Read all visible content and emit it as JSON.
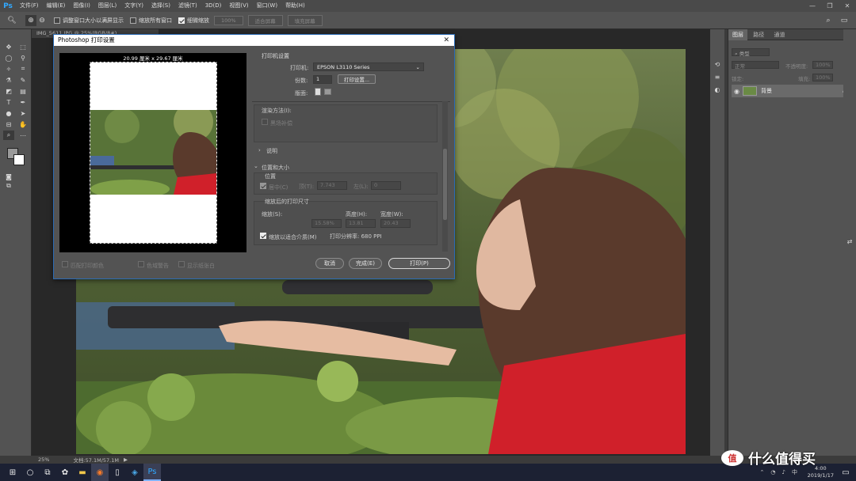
{
  "app": {
    "logo": "Ps",
    "menu": [
      "文件(F)",
      "编辑(E)",
      "图像(I)",
      "图层(L)",
      "文字(Y)",
      "选择(S)",
      "滤镜(T)",
      "3D(D)",
      "视图(V)",
      "窗口(W)",
      "帮助(H)"
    ]
  },
  "options": {
    "resize_windows": "调整窗口大小以满屏显示",
    "zoom_all": "缩放所有窗口",
    "scrubby_zoom": "细微缩放",
    "zoom_100": "100%",
    "fit_screen": "适合屏幕",
    "fill_screen": "填充屏幕"
  },
  "document": {
    "tab": "IMG_5611.JPG @ 25%(RGB/8#)",
    "zoom": "25%",
    "doc_size": "文档:57.1M/57.1M"
  },
  "panels": {
    "tabs": [
      "图层",
      "路径",
      "通道"
    ],
    "kind_label": "类型",
    "blend_mode": "正常",
    "opacity_label": "不透明度:",
    "opacity_value": "100%",
    "lock_label": "锁定:",
    "fill_label": "填充:",
    "fill_value": "100%",
    "layer_name": "背景"
  },
  "dialog": {
    "title": "Photoshop 打印设置",
    "paper_size": "20.99 厘米 x 29.67 厘米",
    "printer_section": "打印机设置",
    "printer_label": "打印机:",
    "printer_value": "EPSON L3110 Series",
    "copies_label": "份数:",
    "copies_value": "1",
    "print_settings_btn": "打印设置...",
    "layout_label": "版面:",
    "render_method": "渲染方法(I):",
    "black_point": "黑场补偿",
    "description": "说明",
    "position_size": "位置和大小",
    "position": "位置",
    "center_label": "居中(C)",
    "top_label": "顶(T):",
    "top_value": "7.743",
    "left_label": "左(L):",
    "left_value": "0",
    "scaled_size": "缩放后的打印尺寸",
    "scale_label": "缩放(S):",
    "scale_value": "15.58%",
    "height_label": "高度(H):",
    "height_value": "13.81",
    "width_label": "宽度(W):",
    "width_value": "20.43",
    "scale_to_fit": "缩放以适合介质(M)",
    "resolution": "打印分辨率: 680 PPI",
    "match_colors": "匹配打印颜色",
    "gamut_warning": "色域警告",
    "show_paper_white": "显示纸张白",
    "cancel": "取消",
    "done": "完成(E)",
    "print": "打印(P)"
  },
  "taskbar": {
    "time": "4:00",
    "date": "2019/1/17",
    "ime": "中",
    "watermark": "什么值得买"
  }
}
